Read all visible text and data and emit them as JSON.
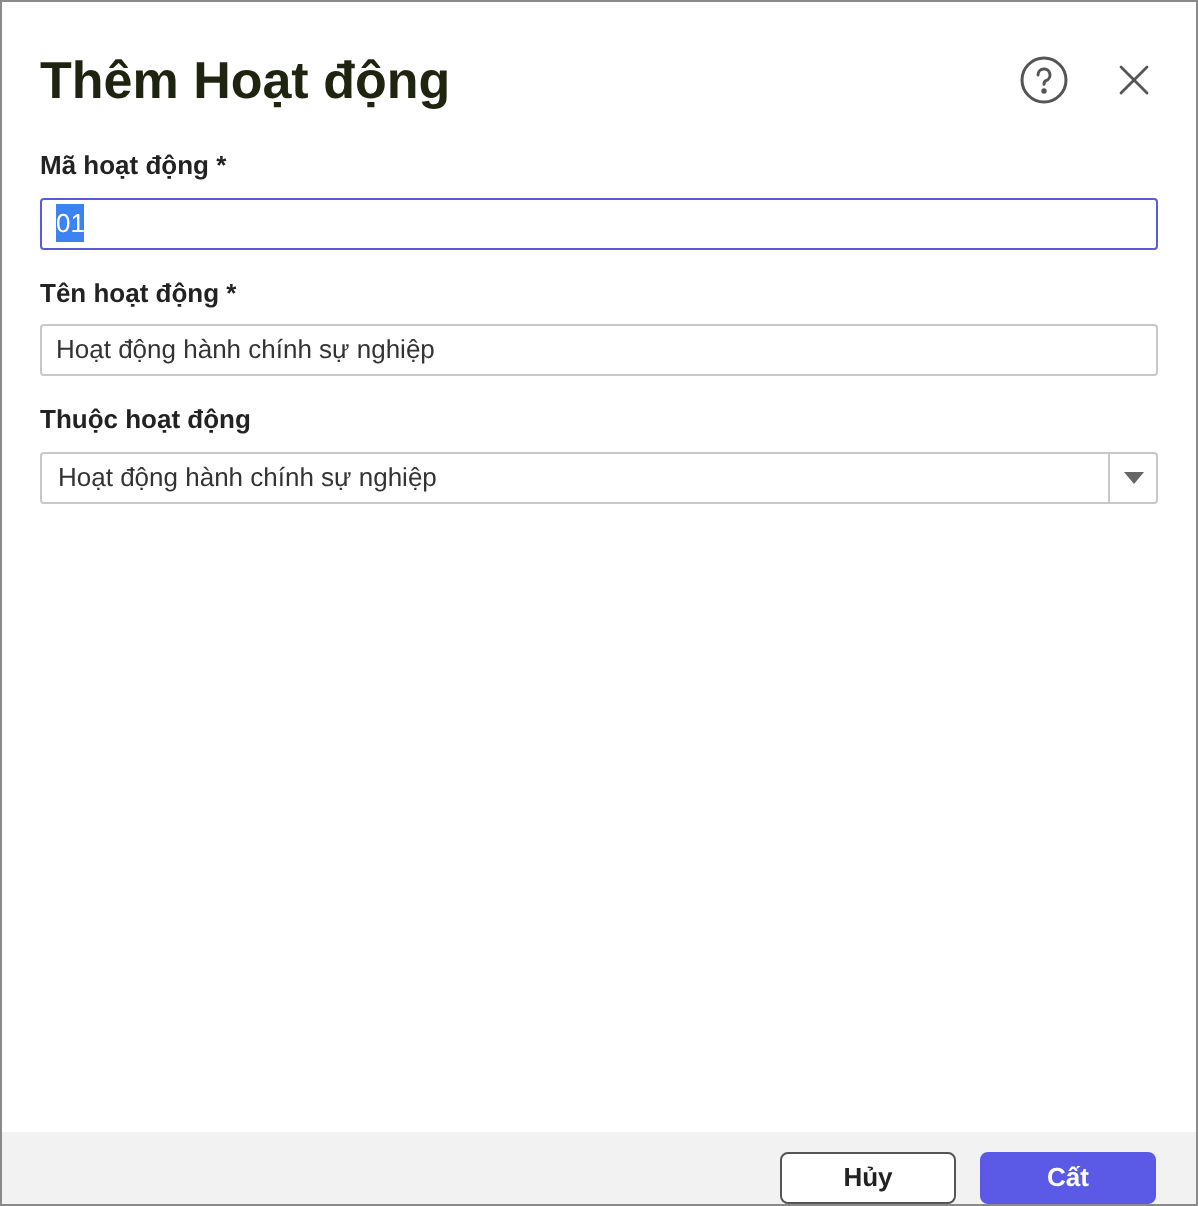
{
  "dialog": {
    "title": "Thêm Hoạt động"
  },
  "fields": [
    {
      "kind": "text",
      "label": "Mã hoạt động *",
      "value": "01",
      "focused": true
    },
    {
      "kind": "text",
      "label": "Tên hoạt động *",
      "value": "Hoạt động hành chính sự nghiệp",
      "focused": false
    },
    {
      "kind": "select",
      "label": "Thuộc hoạt động",
      "value": "Hoạt động hành chính sự nghiệp",
      "focused": false
    }
  ],
  "buttons": [
    {
      "label": "Hủy",
      "kind": "secondary"
    },
    {
      "label": "Cất",
      "kind": "primary"
    }
  ]
}
